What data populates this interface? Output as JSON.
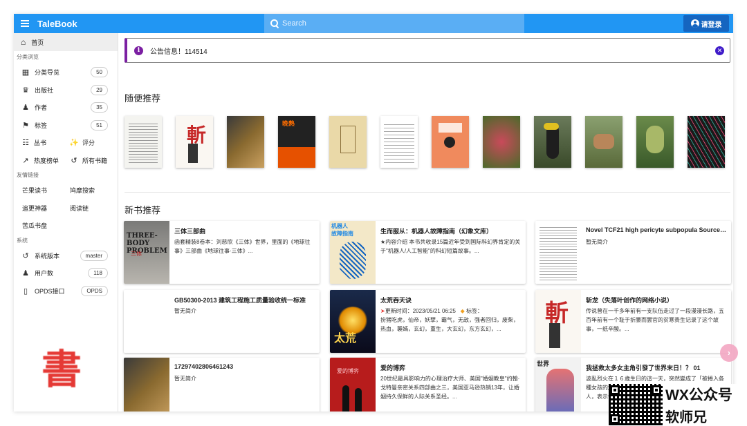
{
  "header": {
    "brand": "TaleBook",
    "search_placeholder": "Search",
    "login_label": "请登录"
  },
  "sidebar": {
    "home": "首页",
    "sections": {
      "browse": "分类浏览",
      "links": "友情链接",
      "system": "系统"
    },
    "browse_items": [
      {
        "label": "分类导览",
        "count": "50",
        "icon": "grid-icon"
      },
      {
        "label": "出版社",
        "count": "29",
        "icon": "publisher-icon"
      },
      {
        "label": "作者",
        "count": "35",
        "icon": "person-icon"
      },
      {
        "label": "标签",
        "count": "51",
        "icon": "tag-icon"
      }
    ],
    "row_a": {
      "left": "丛书",
      "right": "评分"
    },
    "row_b": {
      "left": "热度榜单",
      "right": "所有书籍"
    },
    "friend_links": [
      [
        "芒果读书",
        "鸠摩搜索"
      ],
      [
        "追更神器",
        "阅读链"
      ],
      [
        "苦瓜书盘",
        ""
      ]
    ],
    "system_items": [
      {
        "label": "系统版本",
        "value": "master",
        "icon": "history-icon"
      },
      {
        "label": "用户数",
        "value": "118",
        "icon": "person-icon"
      },
      {
        "label": "OPDS接口",
        "value": "OPDS",
        "icon": "phone-icon"
      }
    ],
    "seal_text": "書"
  },
  "notice": {
    "text": "公告信息！114514"
  },
  "sections": {
    "random": "随便推荐",
    "new": "新书推荐"
  },
  "new_books": [
    {
      "title": "三体三部曲",
      "desc": "函套精装8卷本：刘慈欣《三体》世界，里面的《地球往事》三部曲《地球往事·三体》..."
    },
    {
      "title": "生而服从：机器人故障指南（幻象文库）",
      "desc": "★内容介绍 本书共收录15篇近年受到国际科幻界肯定的关于\"机器人/人工智能\"的科幻短篇故事。..."
    },
    {
      "title": "Novel TCF21 high pericyte subpopula Source Gu...",
      "desc": "暂无简介"
    },
    {
      "title": "GB50300-2013 建筑工程施工质量验收统一标准",
      "desc": "暂无简介"
    },
    {
      "title": "太荒吞天诀",
      "desc_update": "更新时间：2023/05/21 06:25",
      "desc_tag": "标签：",
      "desc": "扮猪吃虎，仙帝，妖孽，霸气，无敌，强者回归，废柴，热血，襲嫣，玄幻，重生，大玄幻，东方玄幻，..."
    },
    {
      "title": "斩龙（失落叶创作的网络小说）",
      "desc": "传说曾在一千多年前有一支队伍走过了一段漫漫长路，五百年前有一个耻于折腰而罢官的贫寒贵生记录了这个故事，一纸辛酸。..."
    },
    {
      "title": "17297402806461243",
      "desc": "暂无简介"
    },
    {
      "title": "爱的博弈",
      "desc": "20世纪最具影响力的心理治疗大师、美国\"婚姻教皇\"约翰·戈特曼亲密关系四部曲之三，美国亚马逊热销13年，让婚姻持久保鲜的人际关系圣经。..."
    },
    {
      "title": "我拯救太多女主角引發了世界末日！？ 01",
      "desc": "波亂烈火在１６歲生日的這一天，突然變成了「被捲入各種女孩的危機」的特異體質，而且還出現一個來自未來的人，表示他的幫助將會..."
    }
  ],
  "watermark": {
    "line1": "WX公众号",
    "line2": "软师兄"
  },
  "colors": {
    "primary": "#2196f3",
    "notice_accent": "#7b1fa2",
    "login_bg": "#1565c0"
  }
}
